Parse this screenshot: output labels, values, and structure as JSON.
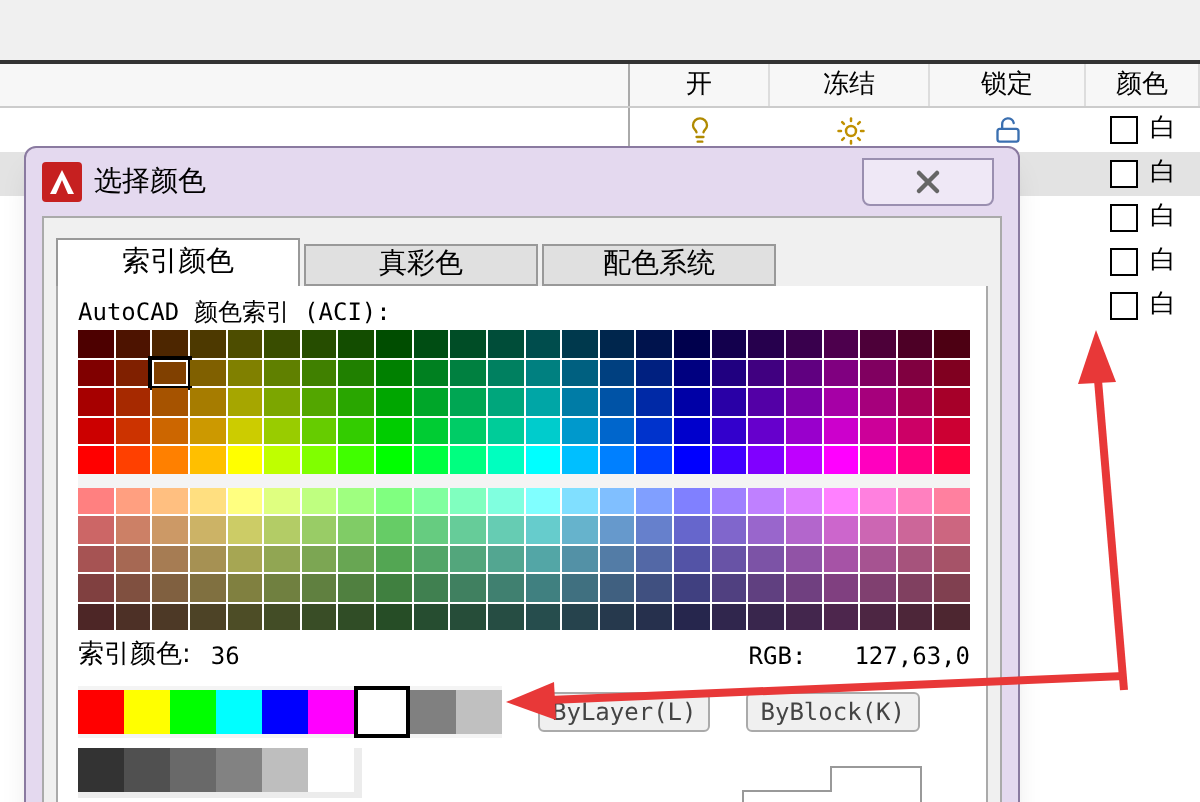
{
  "layer_table": {
    "columns": [
      "开",
      "冻结",
      "锁定",
      "颜色"
    ],
    "rows": [
      {
        "selected": false,
        "on": true,
        "frozen": false,
        "locked": false,
        "color": "#ffffff",
        "color_name": "白"
      },
      {
        "selected": true,
        "color": "#ffffff",
        "color_name": "白"
      },
      {
        "selected": false,
        "color": "#ffffff",
        "color_name": "白"
      },
      {
        "selected": false,
        "color": "#ffffff",
        "color_name": "白"
      },
      {
        "selected": false,
        "color": "#ffffff",
        "color_name": "白"
      }
    ]
  },
  "dialog": {
    "title": "选择颜色",
    "tabs": [
      {
        "label": "索引颜色",
        "selected": true
      },
      {
        "label": "真彩色",
        "selected": false
      },
      {
        "label": "配色系统",
        "selected": false
      }
    ],
    "aci_label": "AutoCAD 颜色索引 (ACI):",
    "upper_rows": [
      {
        "cells": [
          {
            "selected": false
          },
          {
            "selected": false
          },
          {
            "selected": false
          },
          {
            "selected": false
          },
          {
            "selected": false
          },
          {
            "selected": false
          },
          {
            "selected": false
          },
          {
            "selected": false
          },
          {
            "selected": false
          },
          {
            "selected": false
          },
          {
            "selected": false
          },
          {
            "selected": false
          },
          {
            "selected": false
          },
          {
            "selected": false
          },
          {
            "selected": false
          },
          {
            "selected": false
          },
          {
            "selected": false
          },
          {
            "selected": false
          },
          {
            "selected": false
          },
          {
            "selected": false
          },
          {
            "selected": false
          },
          {
            "selected": false
          },
          {
            "selected": false
          },
          {
            "selected": false
          }
        ]
      },
      {
        "cells": [
          {
            "selected": false
          },
          {
            "selected": false
          },
          {
            "selected": true
          },
          {
            "selected": false
          },
          {
            "selected": false
          },
          {
            "selected": false
          },
          {
            "selected": false
          },
          {
            "selected": false
          },
          {
            "selected": false
          },
          {
            "selected": false
          },
          {
            "selected": false
          },
          {
            "selected": false
          },
          {
            "selected": false
          },
          {
            "selected": false
          },
          {
            "selected": false
          },
          {
            "selected": false
          },
          {
            "selected": false
          },
          {
            "selected": false
          },
          {
            "selected": false
          },
          {
            "selected": false
          },
          {
            "selected": false
          },
          {
            "selected": false
          },
          {
            "selected": false
          },
          {
            "selected": false
          }
        ]
      },
      {
        "cells": [
          {
            "selected": false
          },
          {
            "selected": false
          },
          {
            "selected": false
          },
          {
            "selected": false
          },
          {
            "selected": false
          },
          {
            "selected": false
          },
          {
            "selected": false
          },
          {
            "selected": false
          },
          {
            "selected": false
          },
          {
            "selected": false
          },
          {
            "selected": false
          },
          {
            "selected": false
          },
          {
            "selected": false
          },
          {
            "selected": false
          },
          {
            "selected": false
          },
          {
            "selected": false
          },
          {
            "selected": false
          },
          {
            "selected": false
          },
          {
            "selected": false
          },
          {
            "selected": false
          },
          {
            "selected": false
          },
          {
            "selected": false
          },
          {
            "selected": false
          },
          {
            "selected": false
          }
        ]
      },
      {
        "cells": [
          {
            "selected": false
          },
          {
            "selected": false
          },
          {
            "selected": false
          },
          {
            "selected": false
          },
          {
            "selected": false
          },
          {
            "selected": false
          },
          {
            "selected": false
          },
          {
            "selected": false
          },
          {
            "selected": false
          },
          {
            "selected": false
          },
          {
            "selected": false
          },
          {
            "selected": false
          },
          {
            "selected": false
          },
          {
            "selected": false
          },
          {
            "selected": false
          },
          {
            "selected": false
          },
          {
            "selected": false
          },
          {
            "selected": false
          },
          {
            "selected": false
          },
          {
            "selected": false
          },
          {
            "selected": false
          },
          {
            "selected": false
          },
          {
            "selected": false
          },
          {
            "selected": false
          }
        ]
      },
      {
        "cells": [
          {
            "selected": false
          },
          {
            "selected": false
          },
          {
            "selected": false
          },
          {
            "selected": false
          },
          {
            "selected": false
          },
          {
            "selected": false
          },
          {
            "selected": false
          },
          {
            "selected": false
          },
          {
            "selected": false
          },
          {
            "selected": false
          },
          {
            "selected": false
          },
          {
            "selected": false
          },
          {
            "selected": false
          },
          {
            "selected": false
          },
          {
            "selected": false
          },
          {
            "selected": false
          },
          {
            "selected": false
          },
          {
            "selected": false
          },
          {
            "selected": false
          },
          {
            "selected": false
          },
          {
            "selected": false
          },
          {
            "selected": false
          },
          {
            "selected": false
          },
          {
            "selected": false
          }
        ]
      }
    ],
    "index_label": "索引颜色:",
    "index_value": "36",
    "rgb_label": "RGB:",
    "rgb_value": "127,63,0",
    "standard_colors": [
      {
        "color": "#ff0000",
        "selected": false
      },
      {
        "color": "#ffff00",
        "selected": false
      },
      {
        "color": "#00ff00",
        "selected": false
      },
      {
        "color": "#00ffff",
        "selected": false
      },
      {
        "color": "#0000ff",
        "selected": false
      },
      {
        "color": "#ff00ff",
        "selected": false
      },
      {
        "color": "#ffffff",
        "selected": true
      },
      {
        "color": "#808080",
        "selected": false
      },
      {
        "color": "#c0c0c0",
        "selected": false
      }
    ],
    "gray_colors": [
      {
        "color": "#333333",
        "selected": false
      },
      {
        "color": "#505050",
        "selected": false
      },
      {
        "color": "#696969",
        "selected": false
      },
      {
        "color": "#828282",
        "selected": false
      },
      {
        "color": "#bebebe",
        "selected": false
      },
      {
        "color": "#ffffff",
        "selected": false
      }
    ],
    "buttons": [
      "ByLayer(L)",
      "ByBlock(K)"
    ]
  }
}
